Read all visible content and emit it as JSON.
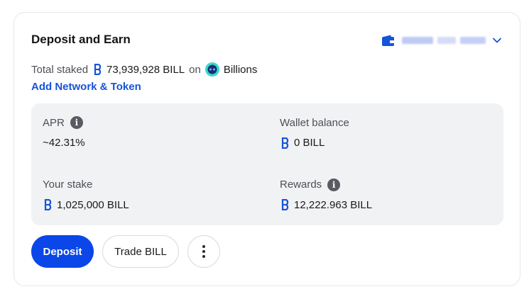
{
  "card": {
    "title": "Deposit and Earn",
    "wallet": {
      "icon": "wallet-icon",
      "chevron": "chevron-down-icon",
      "accent": "#1554d8"
    },
    "total_staked": {
      "label": "Total staked",
      "amount": "73,939,928 BILL",
      "connector": "on",
      "network": "Billions",
      "token_icon": "bill-token-icon",
      "network_icon": "billions-network-icon"
    },
    "add_network_link": "Add Network & Token",
    "stats": {
      "apr": {
        "label": "APR",
        "value": "~42.31%",
        "icon": "info-icon"
      },
      "wallet_balance": {
        "label": "Wallet balance",
        "value": "0 BILL"
      },
      "your_stake": {
        "label": "Your stake",
        "value": "1,025,000 BILL"
      },
      "rewards": {
        "label": "Rewards",
        "value": "12,222.963 BILL",
        "icon": "info-icon"
      }
    },
    "actions": {
      "deposit": "Deposit",
      "trade": "Trade BILL",
      "more": "more-options-icon"
    }
  },
  "colors": {
    "primary": "#0a46e8",
    "link": "#1554d8",
    "panel": "#f1f2f4",
    "text": "#1a1a1a",
    "muted": "#4c4f55"
  }
}
